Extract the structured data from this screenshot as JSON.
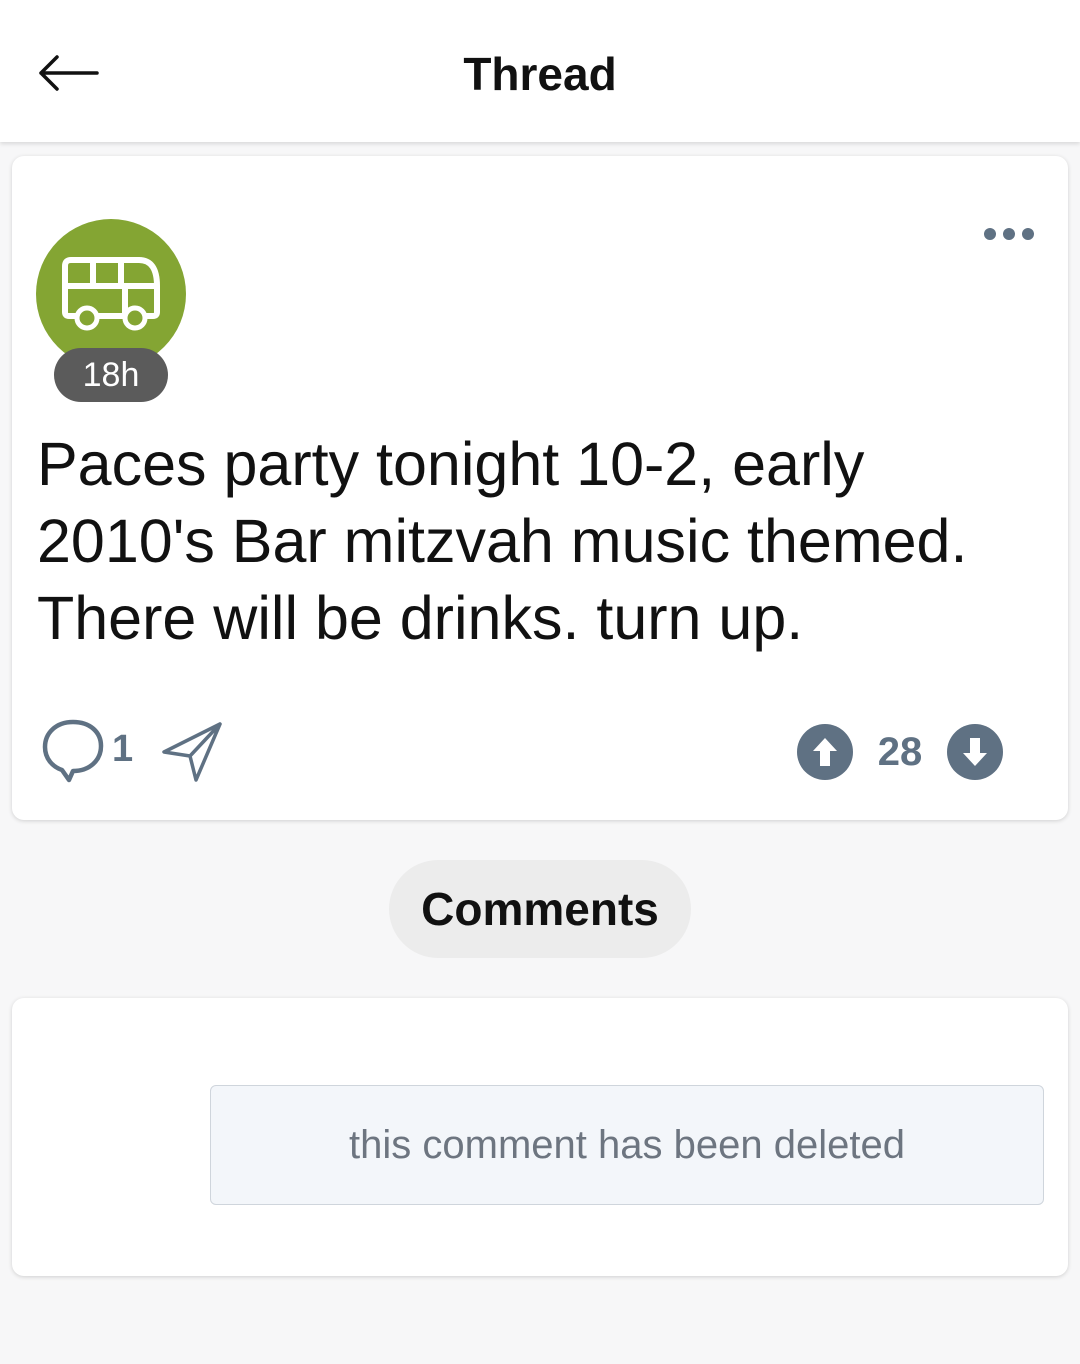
{
  "header": {
    "title": "Thread",
    "back_icon": "arrow-left-icon"
  },
  "post": {
    "avatar_icon": "bus-icon",
    "avatar_color": "#84a533",
    "time": "18h",
    "text": "Paces party tonight 10-2, early 2010's Bar mitzvah music themed. There will be drinks. turn up.",
    "comment_count": "1",
    "vote_count": "28",
    "accent_color": "#5f7183"
  },
  "comments_tab": {
    "label": "Comments"
  },
  "comments": [
    {
      "text": "this comment has been deleted"
    }
  ]
}
